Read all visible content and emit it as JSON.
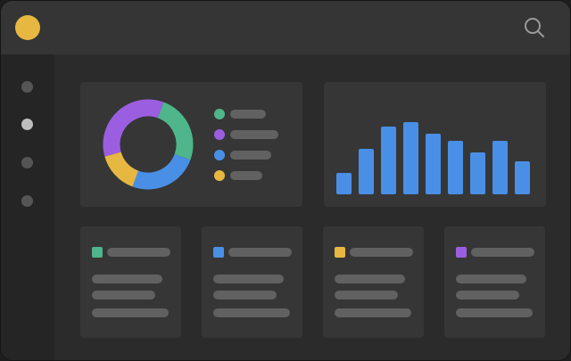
{
  "colors": {
    "accent_yellow": "#e6b842",
    "green": "#4fb58a",
    "purple": "#9b5ee0",
    "blue": "#4a8fe6",
    "yellow": "#e6b842",
    "skeleton": "#616161"
  },
  "icons": {
    "logo": "yellow-circle-logo",
    "search": "search-icon"
  },
  "sidebar": {
    "items": [
      {
        "name": "nav-item-1",
        "active": false
      },
      {
        "name": "nav-item-2",
        "active": true
      },
      {
        "name": "nav-item-3",
        "active": false
      },
      {
        "name": "nav-item-4",
        "active": false
      }
    ]
  },
  "donut": {
    "segments": [
      {
        "color": "green",
        "fraction": 0.25
      },
      {
        "color": "blue",
        "fraction": 0.25
      },
      {
        "color": "yellow",
        "fraction": 0.15
      },
      {
        "color": "purple",
        "fraction": 0.35
      }
    ],
    "legend_colors": [
      "green",
      "purple",
      "blue",
      "yellow"
    ]
  },
  "chart_data": {
    "type": "bar",
    "values": [
      24,
      51,
      76,
      81,
      68,
      60,
      47,
      60,
      37
    ],
    "ylim": [
      0,
      100
    ]
  },
  "stat_cards": [
    {
      "color": "green"
    },
    {
      "color": "blue"
    },
    {
      "color": "yellow"
    },
    {
      "color": "purple"
    }
  ]
}
